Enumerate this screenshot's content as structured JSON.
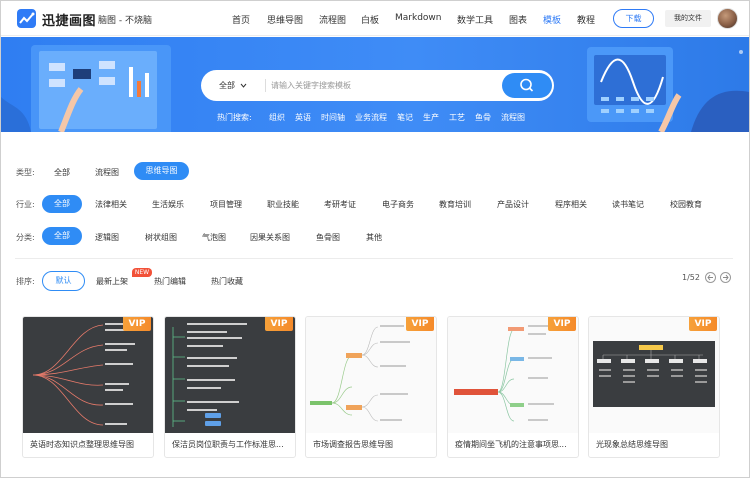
{
  "header": {
    "logo_text": "迅捷画图",
    "logo_sub": "脑图 - 不烧脑",
    "nav": [
      "首页",
      "思维导图",
      "流程图",
      "白板",
      "Markdown",
      "数学工具",
      "图表",
      "模板",
      "教程"
    ],
    "active_nav": "模板",
    "download_label": "下载",
    "my_files_label": "我的文件"
  },
  "banner": {
    "search_category": "全部",
    "search_placeholder": "请输入关键字搜索模板",
    "hot_label": "热门搜索:",
    "hot_terms": [
      "组织",
      "英语",
      "时间轴",
      "业务流程",
      "笔记",
      "生产",
      "工艺",
      "鱼骨",
      "流程图"
    ]
  },
  "filters": {
    "type": {
      "label": "类型:",
      "options": [
        "全部",
        "流程图",
        "思维导图"
      ],
      "selected": "思维导图"
    },
    "industry": {
      "label": "行业:",
      "options": [
        "全部",
        "法律相关",
        "生活娱乐",
        "项目管理",
        "职业技能",
        "考研考证",
        "电子商务",
        "教育培训",
        "产品设计",
        "程序相关",
        "读书笔记",
        "校园教育"
      ],
      "selected": "全部"
    },
    "category": {
      "label": "分类:",
      "options": [
        "全部",
        "逻辑图",
        "树状组图",
        "气泡图",
        "因果关系图",
        "鱼骨图",
        "其他"
      ],
      "selected": "全部"
    }
  },
  "sort": {
    "label": "排序:",
    "options": [
      "默认",
      "最新上架",
      "热门编辑",
      "热门收藏"
    ],
    "selected": "默认",
    "new_badge": "NEW",
    "page_indicator": "1/52"
  },
  "cards": [
    {
      "title": "英语时态知识点整理思维导图",
      "vip": "VIP",
      "theme": "dark"
    },
    {
      "title": "保洁员岗位职责与工作标准思...",
      "vip": "VIP",
      "theme": "dark"
    },
    {
      "title": "市场调查报告思维导图",
      "vip": "VIP",
      "theme": "light"
    },
    {
      "title": "疫情期间坐飞机的注意事项思...",
      "vip": "VIP",
      "theme": "light"
    },
    {
      "title": "光现象总结思维导图",
      "vip": "VIP",
      "theme": "light"
    }
  ],
  "colors": {
    "accent": "#2f8cf5",
    "banner": "#3a88f4",
    "vip": "#f69a33",
    "new_badge": "#f25138"
  },
  "icons": [
    "logo-icon",
    "chevron-down-icon",
    "search-icon",
    "arrow-left-icon",
    "arrow-right-icon"
  ]
}
